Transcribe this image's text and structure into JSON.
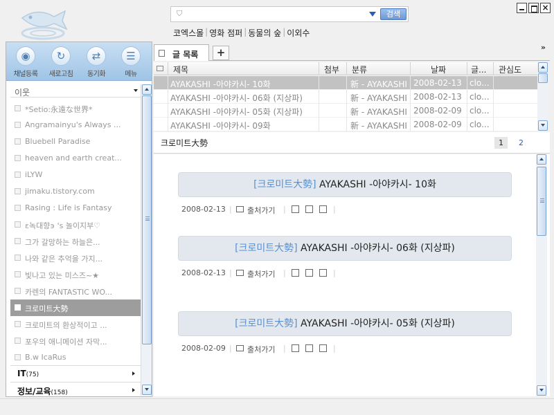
{
  "search": {
    "placeholder": "",
    "button_label": "검색"
  },
  "quick_links": [
    "코엑스몰",
    "영화 점퍼",
    "동물의 숲",
    "이외수"
  ],
  "window_controls": {
    "minimize": "",
    "maximize": "",
    "close": "×"
  },
  "toolbar": [
    {
      "label": "채널등록",
      "icon": "rss-add-icon",
      "glyph": "◉"
    },
    {
      "label": "새로고침",
      "icon": "refresh-icon",
      "glyph": "↻"
    },
    {
      "label": "동기화",
      "icon": "sync-icon",
      "glyph": "⇄"
    },
    {
      "label": "메뉴",
      "icon": "menu-icon",
      "glyph": "☰"
    }
  ],
  "neighbor_section": {
    "title": "이웃"
  },
  "feeds": [
    {
      "name": "*Setio:永遠な世界*",
      "selected": false
    },
    {
      "name": "Angramainyu's Always ...",
      "selected": false
    },
    {
      "name": "Bluebell Paradise",
      "selected": false
    },
    {
      "name": "heaven and earth creat...",
      "selected": false
    },
    {
      "name": "iLYW",
      "selected": false
    },
    {
      "name": "jimaku.tistory.com",
      "selected": false
    },
    {
      "name": "Rasing : Life is Fantasy",
      "selected": false
    },
    {
      "name": "ε녹대향϶ 's 놀이지부♡",
      "selected": false
    },
    {
      "name": "그가 갈망하는 하늘은...",
      "selected": false
    },
    {
      "name": "나와 같은 추억을 가지...",
      "selected": false
    },
    {
      "name": "빛나고 있는 미스즈~★",
      "selected": false
    },
    {
      "name": "카렌의 FANTASTIC WO...",
      "selected": false
    },
    {
      "name": "크로미트大勢",
      "selected": true
    },
    {
      "name": "크로미트의 환상적이고 ...",
      "selected": false
    },
    {
      "name": "포우의 애니메이션 자막...",
      "selected": false
    },
    {
      "name": "B.w IcaRus",
      "selected": false
    }
  ],
  "categories": [
    {
      "label": "IT",
      "count": "(75)"
    },
    {
      "label": "정보/교육",
      "count": "(158)"
    }
  ],
  "tabs": {
    "active_label": "글 목록",
    "add_label": "+",
    "overflow": "»"
  },
  "post_table": {
    "headers": {
      "title": "제목",
      "attach": "첨부",
      "category": "분류",
      "date": "날짜",
      "writer": "글...",
      "interest": "관심도"
    },
    "rows": [
      {
        "title": "AYAKASHI -아야카시- 10화",
        "attach": "",
        "category": "新 - AYAKASHI",
        "date": "2008-02-13",
        "writer": "clo...",
        "interest": "",
        "selected": true
      },
      {
        "title": "AYAKASHI -아야카시- 06화 (지상파)",
        "attach": "",
        "category": "新 - AYAKASHI",
        "date": "2008-02-13",
        "writer": "clo...",
        "interest": "",
        "selected": false
      },
      {
        "title": "AYAKASHI -아야카시- 05화 (지상파)",
        "attach": "",
        "category": "新 - AYAKASHI",
        "date": "2008-02-09",
        "writer": "clo...",
        "interest": "",
        "selected": false
      },
      {
        "title": "AYAKASHI -아야카시- 09화",
        "attach": "",
        "category": "新 - AYAKASHI",
        "date": "2008-02-09",
        "writer": "clo...",
        "interest": "",
        "selected": false
      }
    ]
  },
  "reader": {
    "blog_title": "크로미트大勢",
    "pages": [
      "1",
      "2"
    ],
    "source_label": "출처가기",
    "posts": [
      {
        "tag": "[크로미트大勢]",
        "title": "AYAKASHI -아야카시- 10화",
        "date": "2008-02-13"
      },
      {
        "tag": "[크로미트大勢]",
        "title": "AYAKASHI -아야카시- 06화 (지상파)",
        "date": "2008-02-13"
      },
      {
        "tag": "[크로미트大勢]",
        "title": "AYAKASHI -아야카시- 05화 (지상파)",
        "date": "2008-02-09"
      }
    ]
  },
  "colors": {
    "accent_blue": "#5a8fd0",
    "toolbar_blue": "#b3d1ee",
    "selected_gray": "#9d9d9d"
  }
}
